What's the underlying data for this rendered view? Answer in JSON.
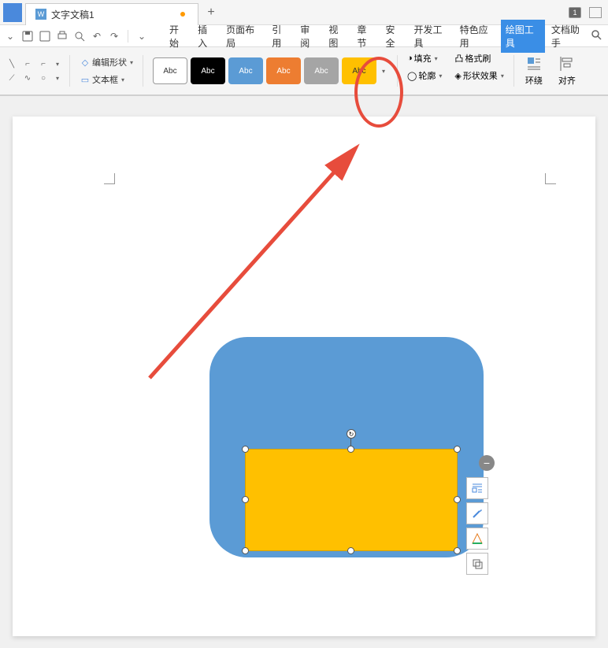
{
  "tab": {
    "title": "文字文稿1",
    "doc_type": "W"
  },
  "badge": "1",
  "menu": {
    "items": [
      "开始",
      "插入",
      "页面布局",
      "引用",
      "审阅",
      "视图",
      "章节",
      "安全",
      "开发工具",
      "特色应用",
      "绘图工具",
      "文档助手"
    ],
    "active_index": 10
  },
  "ribbon": {
    "edit_shape": "编辑形状",
    "text_box": "文本框",
    "style_label": "Abc",
    "fill": "填充",
    "outline": "轮廓",
    "format_painter": "格式刷",
    "shape_effect": "形状效果",
    "wrap": "环绕",
    "align": "对齐"
  },
  "styles": [
    {
      "bg": "#fff",
      "fg": "#333"
    },
    {
      "bg": "#000",
      "fg": "#fff"
    },
    {
      "bg": "#5b9bd5",
      "fg": "#fff"
    },
    {
      "bg": "#ed7d31",
      "fg": "#fff"
    },
    {
      "bg": "#a5a5a5",
      "fg": "#fff"
    },
    {
      "bg": "#ffc000",
      "fg": "#333"
    }
  ],
  "shapes": {
    "blue": {
      "color": "#5b9bd5",
      "radius": 48
    },
    "orange": {
      "color": "#ffc000",
      "selected": true
    }
  },
  "annotation": {
    "circle_target": "yellow-style-swatch"
  }
}
